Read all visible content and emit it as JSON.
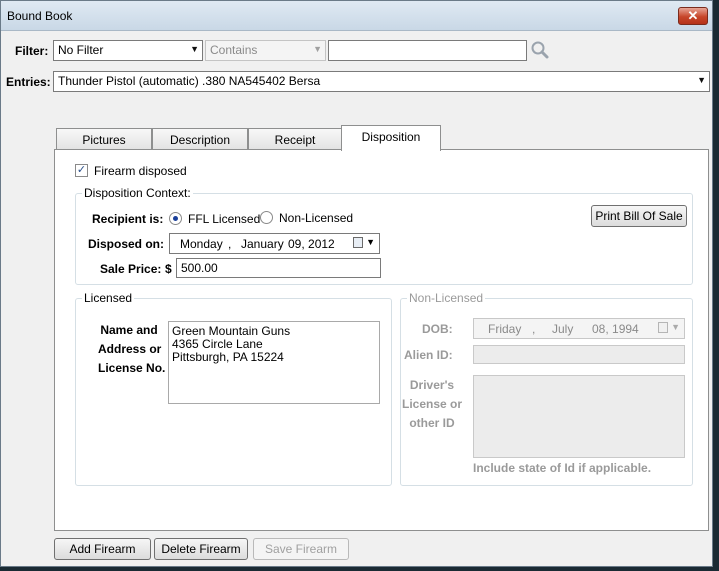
{
  "window": {
    "title": "Bound Book",
    "close_glyph": "✕"
  },
  "filter": {
    "label": "Filter:",
    "selected": "No Filter",
    "operator": "Contains",
    "search_value": ""
  },
  "entries": {
    "label": "Entries:",
    "selected": "Thunder Pistol (automatic) .380 NA545402 Bersa"
  },
  "tabs": [
    {
      "label": "Pictures"
    },
    {
      "label": "Description"
    },
    {
      "label": "Receipt"
    },
    {
      "label": "Disposition"
    }
  ],
  "disposition": {
    "firearm_disposed_label": "Firearm disposed",
    "firearm_disposed_checked": true,
    "context_title": "Disposition Context:",
    "recipient_label": "Recipient is:",
    "ffl_licensed_label": "FFL Licensed",
    "non_licensed_label": "Non-Licensed",
    "recipient_selected": "FFL Licensed",
    "print_button": "Print Bill Of Sale",
    "disposed_on_label": "Disposed on:",
    "disposed_on": {
      "weekday": "Monday",
      "sep": ",",
      "month": "January",
      "day_year": "09, 2012"
    },
    "sale_price_label": "Sale Price:",
    "currency_symbol": "$",
    "sale_price": "500.00"
  },
  "licensed": {
    "title": "Licensed",
    "name_label_lines": [
      "Name and",
      "Address or",
      "License No."
    ],
    "address_lines": [
      "Green Mountain Guns",
      "4365 Circle Lane",
      "Pittsburgh, PA 15224"
    ]
  },
  "non_licensed": {
    "title": "Non-Licensed",
    "dob_label": "DOB:",
    "dob": {
      "weekday": "Friday",
      "sep": ",",
      "month": "July",
      "day_year": "08, 1994"
    },
    "alien_id_label": "Alien ID:",
    "alien_id": "",
    "drivers_label_lines": [
      "Driver's",
      "License or",
      "other ID"
    ],
    "drivers_value": "",
    "hint": "Include state of Id if applicable."
  },
  "footer_buttons": {
    "add": "Add Firearm",
    "delete": "Delete Firearm",
    "save": "Save Firearm"
  },
  "colors": {
    "accent": "#1a3f9a",
    "close_button": "#c7462a"
  }
}
